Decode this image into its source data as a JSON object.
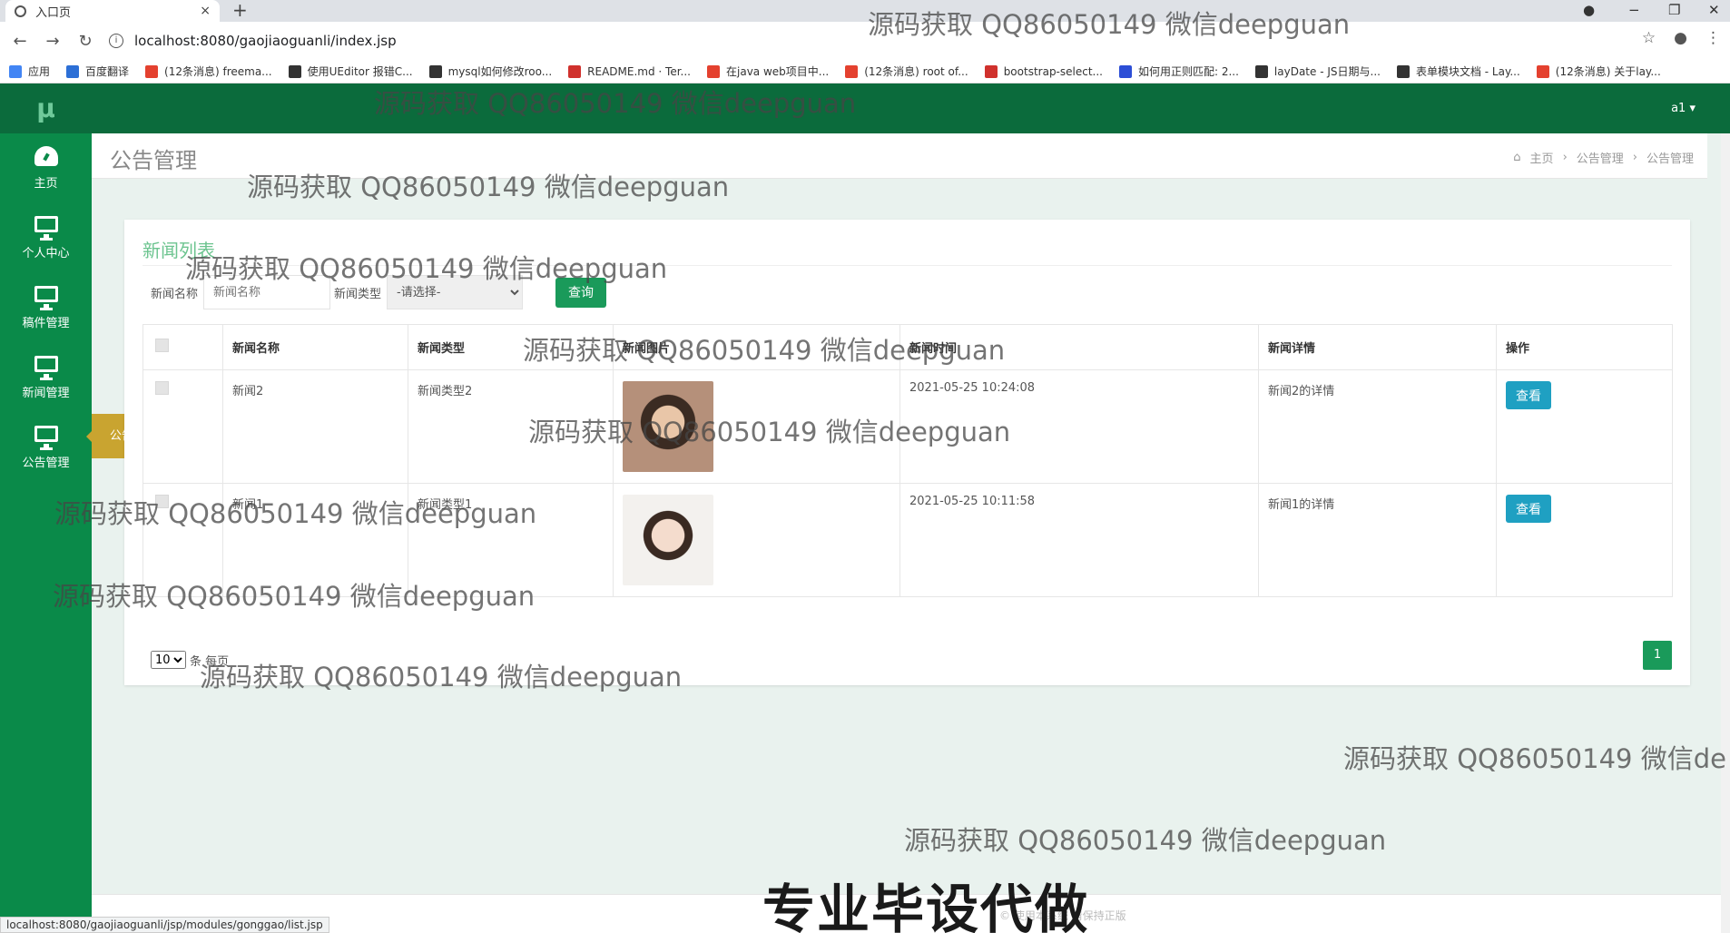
{
  "browser": {
    "tab_title": "入口页",
    "tab_close": "×",
    "new_tab": "+",
    "url": "localhost:8080/gaojiaoguanli/index.jsp",
    "win_min": "−",
    "win_max": "❐",
    "win_close": "✕",
    "bookmarks": [
      {
        "label": "应用",
        "color": "#4285f4"
      },
      {
        "label": "百度翻译",
        "color": "#2c6fd6"
      },
      {
        "label": "(12条消息) freema...",
        "color": "#e4412f"
      },
      {
        "label": "使用UEditor 报错C...",
        "color": "#333333"
      },
      {
        "label": "mysql如何修改roo...",
        "color": "#333333"
      },
      {
        "label": "README.md · Ter...",
        "color": "#d0312d"
      },
      {
        "label": "在java web项目中...",
        "color": "#e4412f"
      },
      {
        "label": "(12条消息) root of...",
        "color": "#e4412f"
      },
      {
        "label": "bootstrap-select...",
        "color": "#d0312d"
      },
      {
        "label": "如何用正则匹配: 2...",
        "color": "#2c4ed6"
      },
      {
        "label": "layDate - JS日期与...",
        "color": "#333333"
      },
      {
        "label": "表单模块文档 - Lay...",
        "color": "#333333"
      },
      {
        "label": "(12条消息) 关于lay...",
        "color": "#e4412f"
      }
    ],
    "status_url": "localhost:8080/gaojiaoguanli/jsp/modules/gonggao/list.jsp"
  },
  "app": {
    "logo": "μ",
    "user": "a1 ▾",
    "sidebar": [
      {
        "label": "主页",
        "icon": "dashboard-icon"
      },
      {
        "label": "个人中心",
        "icon": "monitor-icon"
      },
      {
        "label": "稿件管理",
        "icon": "monitor-icon"
      },
      {
        "label": "新闻管理",
        "icon": "monitor-icon"
      },
      {
        "label": "公告管理",
        "icon": "monitor-icon"
      }
    ],
    "flyout": "公告管理",
    "page_title": "公告管理",
    "breadcrumb": [
      "主页",
      "公告管理",
      "公告管理"
    ],
    "breadcrumb_sep": "›",
    "card_title": "新闻列表",
    "filter": {
      "name_label": "新闻名称",
      "name_placeholder": "新闻名称",
      "type_label": "新闻类型",
      "type_selected": "-请选择-",
      "query_button": "查询"
    },
    "table": {
      "headers": [
        "新闻名称",
        "新闻类型",
        "新闻图片",
        "新闻时间",
        "新闻详情",
        "操作"
      ],
      "rows": [
        {
          "name": "新闻2",
          "type": "新闻类型2",
          "time": "2021-05-25 10:24:08",
          "detail": "新闻2的详情",
          "action": "查看"
        },
        {
          "name": "新闻1",
          "type": "新闻类型1",
          "time": "2021-05-25 10:11:58",
          "detail": "新闻1的详情",
          "action": "查看"
        }
      ]
    },
    "page_size": "10",
    "page_size_suffix": "条 每页",
    "current_page": "1",
    "footer": "© 使用本系统 请保持正版"
  },
  "overlay": {
    "watermark": "源码获取 QQ86050149 微信deepguan",
    "watermark_cut": "源码获取 QQ86050149 微信de",
    "promo": "专业毕设代做"
  }
}
